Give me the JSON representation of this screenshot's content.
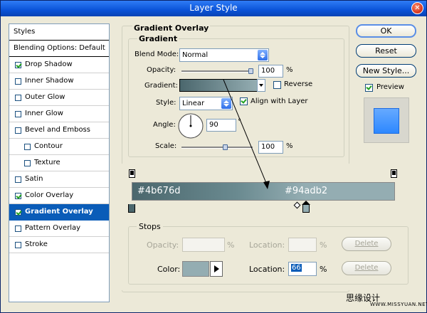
{
  "window": {
    "title": "Layer Style"
  },
  "styles_panel": {
    "header": "Styles",
    "blending": "Blending Options: Default",
    "items": [
      {
        "label": "Drop Shadow",
        "checked": true
      },
      {
        "label": "Inner Shadow",
        "checked": false
      },
      {
        "label": "Outer Glow",
        "checked": false
      },
      {
        "label": "Inner Glow",
        "checked": false
      },
      {
        "label": "Bevel and Emboss",
        "checked": false
      },
      {
        "label": "Contour",
        "checked": false
      },
      {
        "label": "Texture",
        "checked": false
      },
      {
        "label": "Satin",
        "checked": false
      },
      {
        "label": "Color Overlay",
        "checked": true
      },
      {
        "label": "Gradient Overlay",
        "checked": true,
        "selected": true
      },
      {
        "label": "Pattern Overlay",
        "checked": false
      },
      {
        "label": "Stroke",
        "checked": false
      }
    ]
  },
  "gradient_overlay": {
    "section_title": "Gradient Overlay",
    "sub_title": "Gradient",
    "blend_mode_label": "Blend Mode:",
    "blend_mode_value": "Normal",
    "opacity_label": "Opacity:",
    "opacity_value": "100",
    "opacity_unit": "%",
    "gradient_label": "Gradient:",
    "reverse_label": "Reverse",
    "style_label": "Style:",
    "style_value": "Linear",
    "align_label": "Align with Layer",
    "angle_label": "Angle:",
    "angle_value": "90",
    "angle_unit": "°",
    "scale_label": "Scale:",
    "scale_value": "100",
    "scale_unit": "%"
  },
  "gradient_editor": {
    "start_color": "#4b676d",
    "end_color": "#94adb2",
    "stops_title": "Stops",
    "opacity_label": "Opacity:",
    "opacity_unit": "%",
    "location_label": "Location:",
    "location_unit": "%",
    "delete_label": "Delete",
    "color_label": "Color:",
    "color_location_value": "66",
    "color_location_unit": "%",
    "color_swatch": "#94adb2"
  },
  "buttons": {
    "ok": "OK",
    "reset": "Reset",
    "new_style": "New Style...",
    "preview": "Preview"
  },
  "watermark": {
    "cn": "思缘设计",
    "url": "WWW.MISSYUAN.NET"
  }
}
